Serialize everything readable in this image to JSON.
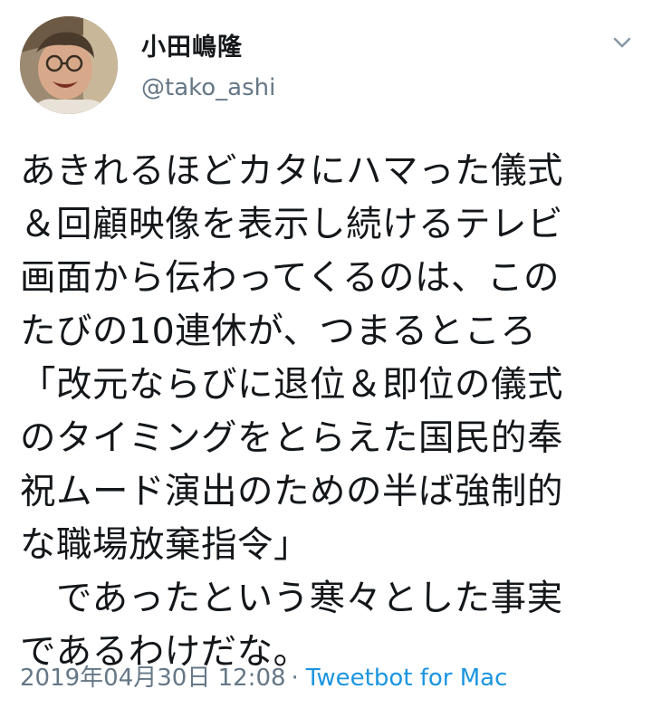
{
  "author": {
    "display_name": "小田嶋隆",
    "handle": "@tako_ashi"
  },
  "icons": {
    "menu": "chevron-down-icon"
  },
  "tweet": {
    "lines": [
      "あきれるほどカタにハマった儀式",
      "＆回顧映像を表示し続けるテレビ",
      "画面から伝わってくるのは、この",
      "たびの10連休が、つまるところ",
      "「改元ならびに退位＆即位の儀式",
      "のタイミングをとらえた国民的奉",
      "祝ムード演出のための半ば強制的",
      "な職場放棄指令」",
      "　であったという寒々とした事実",
      "であるわけだな。"
    ],
    "timestamp": "2019年04月30日 12:08",
    "separator": "·",
    "source": "Tweetbot for Mac"
  },
  "colors": {
    "text": "#14171a",
    "secondary": "#657786",
    "link": "#1b95e0"
  }
}
